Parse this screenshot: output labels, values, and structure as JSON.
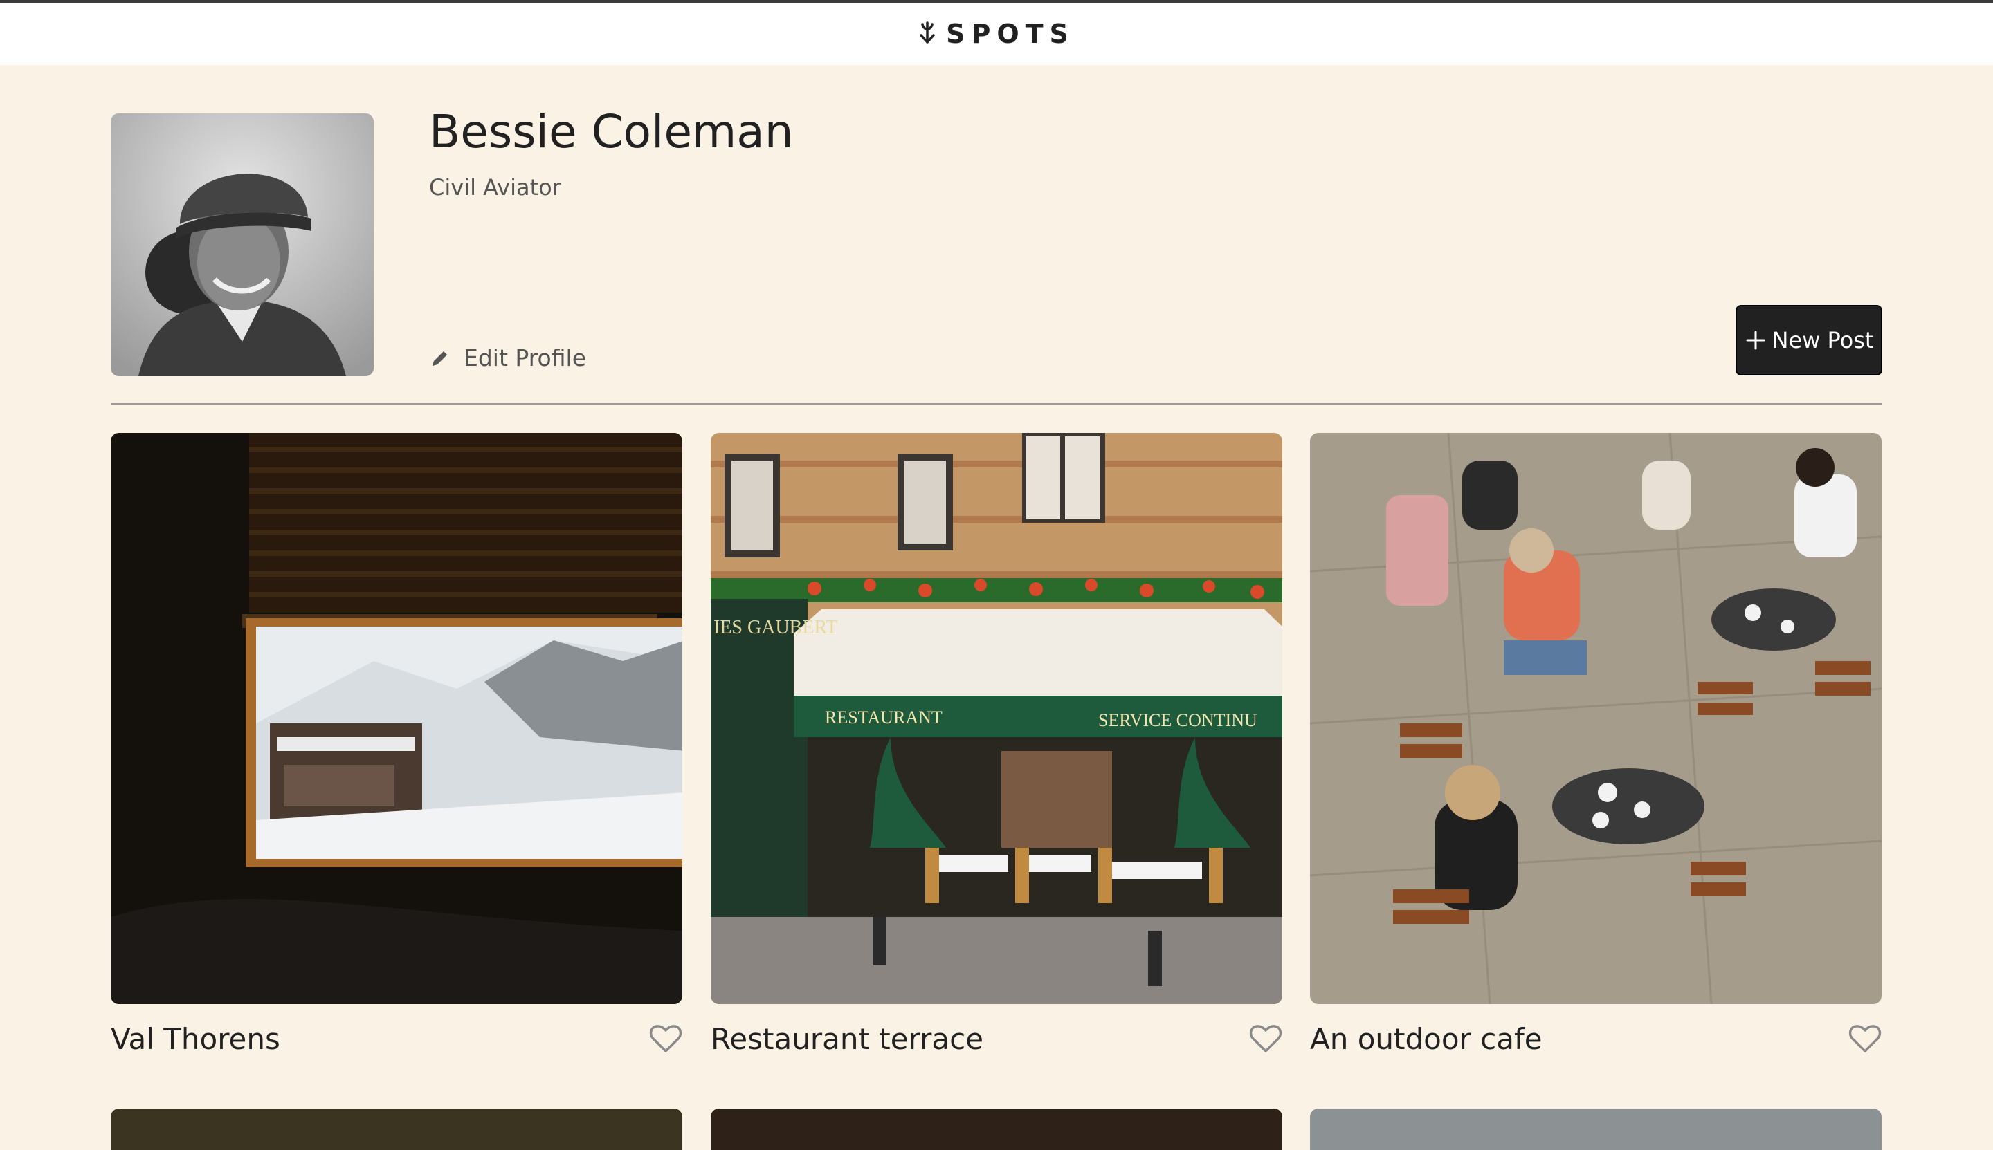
{
  "header": {
    "logo_text": "SPOTS",
    "logo_icon": "down-arrow-sprout-icon"
  },
  "profile": {
    "name": "Bessie Coleman",
    "description": "Civil Aviator",
    "edit_label": "Edit Profile",
    "edit_icon": "pencil-icon"
  },
  "new_post": {
    "label": "New Post",
    "icon": "plus-icon"
  },
  "cards": [
    {
      "title": "Val Thorens",
      "like_icon": "heart-outline-icon"
    },
    {
      "title": "Restaurant terrace",
      "like_icon": "heart-outline-icon"
    },
    {
      "title": "An outdoor cafe",
      "like_icon": "heart-outline-icon"
    }
  ],
  "colors": {
    "background": "#FAF2E4",
    "header": "#FFFFFF",
    "text": "#212121",
    "muted": "#555555",
    "button": "#212121"
  }
}
